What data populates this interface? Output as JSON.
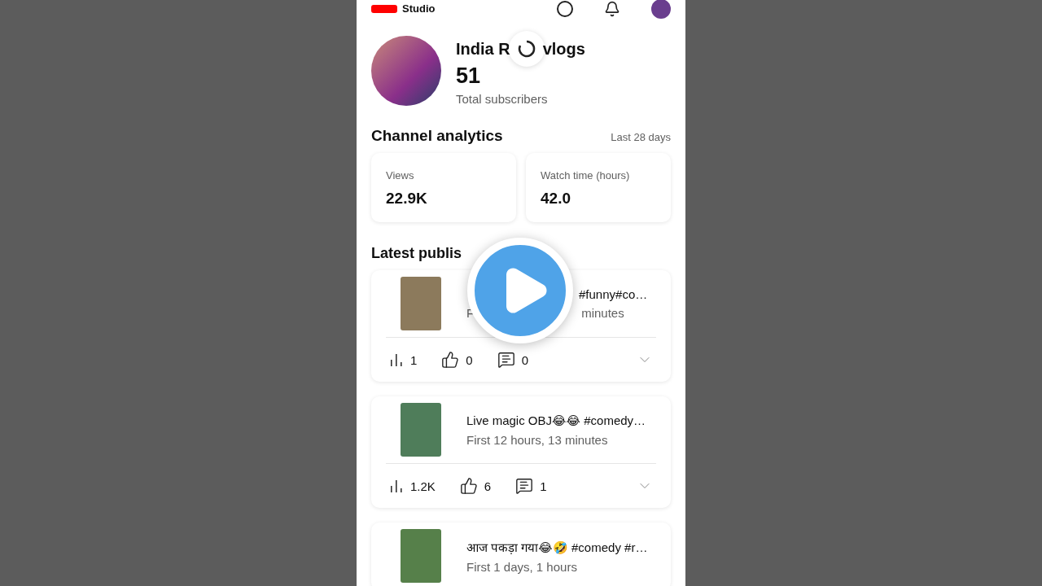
{
  "header": {
    "logo_text": "Studio"
  },
  "channel": {
    "name_parts": [
      "India R",
      "vlogs"
    ],
    "subscribers": "51",
    "subscribers_label": "Total subscribers"
  },
  "analytics": {
    "title": "Channel analytics",
    "period": "Last 28 days",
    "metrics": [
      {
        "label": "Views",
        "value": "22.9K"
      },
      {
        "label": "Watch time (hours)",
        "value": "42.0"
      }
    ]
  },
  "latest": {
    "title": "Latest publis",
    "videos": [
      {
        "title": "#funny#co…",
        "subtitle_parts": [
          "F",
          "minutes"
        ],
        "obscured": true,
        "views": "1",
        "likes": "0",
        "comments": "0"
      },
      {
        "title": "Live magic OBJ😂😂 #comedy…",
        "subtitle_parts": [
          "First 12 hours, 13 minutes"
        ],
        "obscured": false,
        "views": "1.2K",
        "likes": "6",
        "comments": "1"
      },
      {
        "title": "आज पकड़ा गया😂🤣 #comedy #r…",
        "subtitle_parts": [
          "First 1 days, 1 hours"
        ],
        "obscured": false
      }
    ]
  }
}
